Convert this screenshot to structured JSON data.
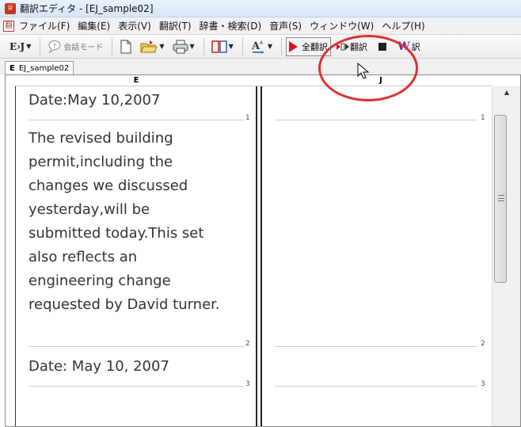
{
  "window": {
    "title": "翻訳エディタ - [EJ_sample02]"
  },
  "menu": [
    "ファイル(F)",
    "編集(E)",
    "表示(V)",
    "翻訳(T)",
    "辞書・検索(D)",
    "音声(S)",
    "ウィンドウ(W)",
    "ヘルプ(H)"
  ],
  "toolbar": {
    "ej_label": "E›J",
    "conversation_mode_label": "会話モード",
    "full_translate_label": "全翻訳",
    "translate_label": "翻訳",
    "partial_label": "訳"
  },
  "tab": {
    "prefix": "E",
    "name": "EJ_sample02"
  },
  "columns": {
    "source_header": "E",
    "target_header": "J"
  },
  "segments": [
    {
      "number": "1",
      "lines": [
        "Date:May 10,2007"
      ],
      "translation": ""
    },
    {
      "number": "2",
      "lines": [
        "The revised building",
        "permit,including the",
        "changes we discussed",
        "yesterday,will be",
        "submitted today.This set",
        "also reflects an",
        "engineering change",
        "requested by David turner."
      ],
      "translation": ""
    },
    {
      "number": "3",
      "lines": [
        "Date: May 10, 2007"
      ],
      "translation": ""
    }
  ],
  "colors": {
    "accent_ring": "#e03030",
    "play_icon": "#d9161c"
  }
}
